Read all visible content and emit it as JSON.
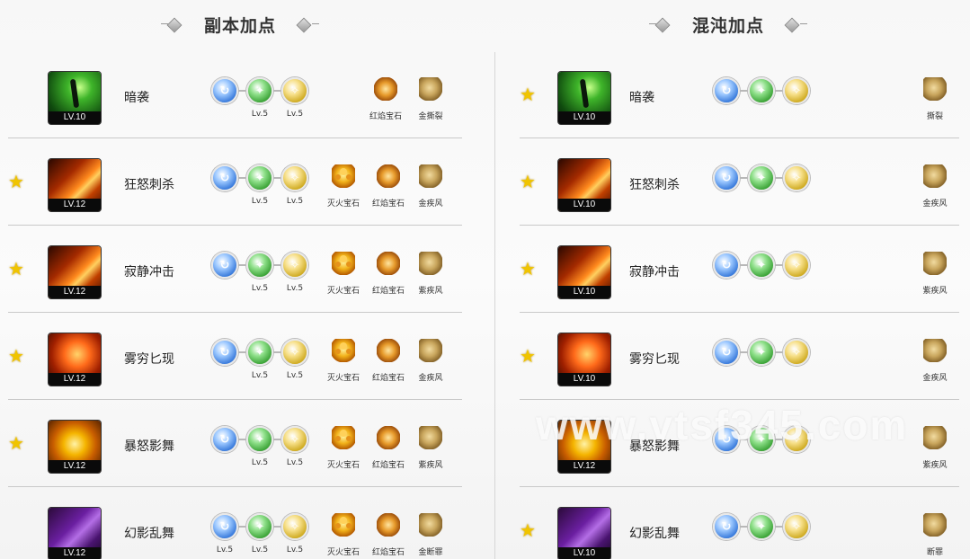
{
  "left": {
    "title": "副本加点",
    "rows": [
      {
        "starred": false,
        "icon": "green",
        "level": "LV.10",
        "name": "暗袭",
        "nodes": [
          {
            "color": "blue",
            "label": ""
          },
          {
            "color": "green",
            "label": "Lv.5"
          },
          {
            "color": "yellow",
            "label": "Lv.5"
          }
        ],
        "gems": [
          {
            "type": "ember",
            "label": "红焰宝石"
          },
          {
            "type": "shell",
            "label": "金撕裂"
          }
        ]
      },
      {
        "starred": true,
        "icon": "fire",
        "level": "LV.12",
        "name": "狂怒刺杀",
        "nodes": [
          {
            "color": "blue",
            "label": ""
          },
          {
            "color": "green",
            "label": "Lv.5"
          },
          {
            "color": "yellow",
            "label": "Lv.5"
          }
        ],
        "gems": [
          {
            "type": "fire",
            "label": "灭火宝石"
          },
          {
            "type": "ember",
            "label": "红焰宝石"
          },
          {
            "type": "shell",
            "label": "金疾风"
          }
        ]
      },
      {
        "starred": true,
        "icon": "fire",
        "level": "LV.12",
        "name": "寂静冲击",
        "nodes": [
          {
            "color": "blue",
            "label": ""
          },
          {
            "color": "green",
            "label": "Lv.5"
          },
          {
            "color": "yellow",
            "label": "Lv.5"
          }
        ],
        "gems": [
          {
            "type": "fire",
            "label": "灭火宝石"
          },
          {
            "type": "ember",
            "label": "红焰宝石"
          },
          {
            "type": "shell",
            "label": "紫疾风"
          }
        ]
      },
      {
        "starred": true,
        "icon": "flame",
        "level": "LV.12",
        "name": "雾穷匕现",
        "nodes": [
          {
            "color": "blue",
            "label": ""
          },
          {
            "color": "green",
            "label": "Lv.5"
          },
          {
            "color": "yellow",
            "label": "Lv.5"
          }
        ],
        "gems": [
          {
            "type": "fire",
            "label": "灭火宝石"
          },
          {
            "type": "ember",
            "label": "红焰宝石"
          },
          {
            "type": "shell",
            "label": "金疾风"
          }
        ]
      },
      {
        "starred": true,
        "icon": "gold",
        "level": "LV.12",
        "name": "暴怒影舞",
        "nodes": [
          {
            "color": "blue",
            "label": ""
          },
          {
            "color": "green",
            "label": "Lv.5"
          },
          {
            "color": "yellow",
            "label": "Lv.5"
          }
        ],
        "gems": [
          {
            "type": "fire",
            "label": "灭火宝石"
          },
          {
            "type": "ember",
            "label": "红焰宝石"
          },
          {
            "type": "shell",
            "label": "紫疾风"
          }
        ]
      },
      {
        "starred": false,
        "icon": "purple",
        "level": "LV.12",
        "name": "幻影乱舞",
        "nodes": [
          {
            "color": "blue",
            "label": "Lv.5"
          },
          {
            "color": "green",
            "label": "Lv.5"
          },
          {
            "color": "yellow",
            "label": "Lv.5"
          }
        ],
        "gems": [
          {
            "type": "fire",
            "label": "灭火宝石"
          },
          {
            "type": "ember",
            "label": "红焰宝石"
          },
          {
            "type": "shell",
            "label": "金断罪"
          }
        ]
      }
    ]
  },
  "right": {
    "title": "混沌加点",
    "rows": [
      {
        "starred": true,
        "icon": "green",
        "level": "LV.10",
        "name": "暗袭",
        "nodes": [
          {
            "color": "blue",
            "label": ""
          },
          {
            "color": "green",
            "label": ""
          },
          {
            "color": "yellow",
            "label": ""
          }
        ],
        "gems": [
          {
            "type": "shell",
            "label": "撕裂"
          }
        ]
      },
      {
        "starred": true,
        "icon": "fire",
        "level": "LV.10",
        "name": "狂怒刺杀",
        "nodes": [
          {
            "color": "blue",
            "label": ""
          },
          {
            "color": "green",
            "label": ""
          },
          {
            "color": "yellow",
            "label": ""
          }
        ],
        "gems": [
          {
            "type": "shell",
            "label": "金疾风"
          }
        ]
      },
      {
        "starred": true,
        "icon": "fire",
        "level": "LV.10",
        "name": "寂静冲击",
        "nodes": [
          {
            "color": "blue",
            "label": ""
          },
          {
            "color": "green",
            "label": ""
          },
          {
            "color": "yellow",
            "label": ""
          }
        ],
        "gems": [
          {
            "type": "shell",
            "label": "紫疾风"
          }
        ]
      },
      {
        "starred": true,
        "icon": "flame",
        "level": "LV.10",
        "name": "雾穷匕现",
        "nodes": [
          {
            "color": "blue",
            "label": ""
          },
          {
            "color": "green",
            "label": ""
          },
          {
            "color": "yellow",
            "label": ""
          }
        ],
        "gems": [
          {
            "type": "shell",
            "label": "金疾风"
          }
        ]
      },
      {
        "starred": false,
        "icon": "gold",
        "level": "LV.12",
        "name": "暴怒影舞",
        "nodes": [
          {
            "color": "blue",
            "label": ""
          },
          {
            "color": "green",
            "label": ""
          },
          {
            "color": "yellow",
            "label": ""
          }
        ],
        "gems": [
          {
            "type": "shell",
            "label": "紫疾风"
          }
        ]
      },
      {
        "starred": true,
        "icon": "purple",
        "level": "LV.10",
        "name": "幻影乱舞",
        "nodes": [
          {
            "color": "blue",
            "label": ""
          },
          {
            "color": "green",
            "label": ""
          },
          {
            "color": "yellow",
            "label": ""
          }
        ],
        "gems": [
          {
            "type": "shell",
            "label": "断罪"
          }
        ]
      }
    ]
  },
  "watermark": "www.vtsf345.com",
  "colors": {
    "star": "#f0c400",
    "divider": "#c9c9c9"
  }
}
